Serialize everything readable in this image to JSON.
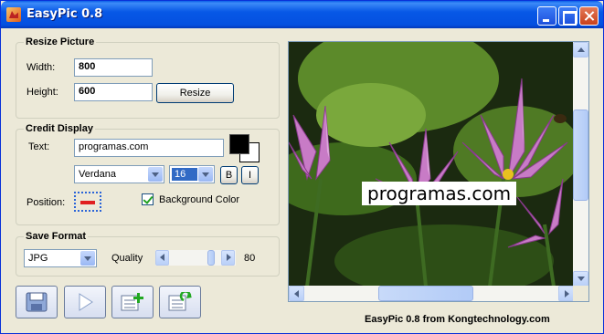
{
  "window": {
    "title": "EasyPic 0.8"
  },
  "resize": {
    "title": "Resize Picture",
    "width_label": "Width:",
    "width_value": "800",
    "height_label": "Height:",
    "height_value": "600",
    "button": "Resize"
  },
  "credit": {
    "title": "Credit Display",
    "text_label": "Text:",
    "text_value": "programas.com",
    "font": "Verdana",
    "size": "16",
    "bold_label": "B",
    "italic_label": "I",
    "position_label": "Position:",
    "background_color_label": "Background Color",
    "background_color_checked": true,
    "fg_color": "#000000",
    "bg_color": "#ffffff"
  },
  "save": {
    "title": "Save Format",
    "format": "JPG",
    "quality_label": "Quality",
    "quality_value": "80"
  },
  "preview": {
    "overlay_text": "programas.com"
  },
  "footer": "EasyPic 0.8 from Kongtechnology.com",
  "toolbar": {
    "icons": [
      "save-icon",
      "play-icon",
      "add-list-icon",
      "refresh-list-icon"
    ]
  }
}
